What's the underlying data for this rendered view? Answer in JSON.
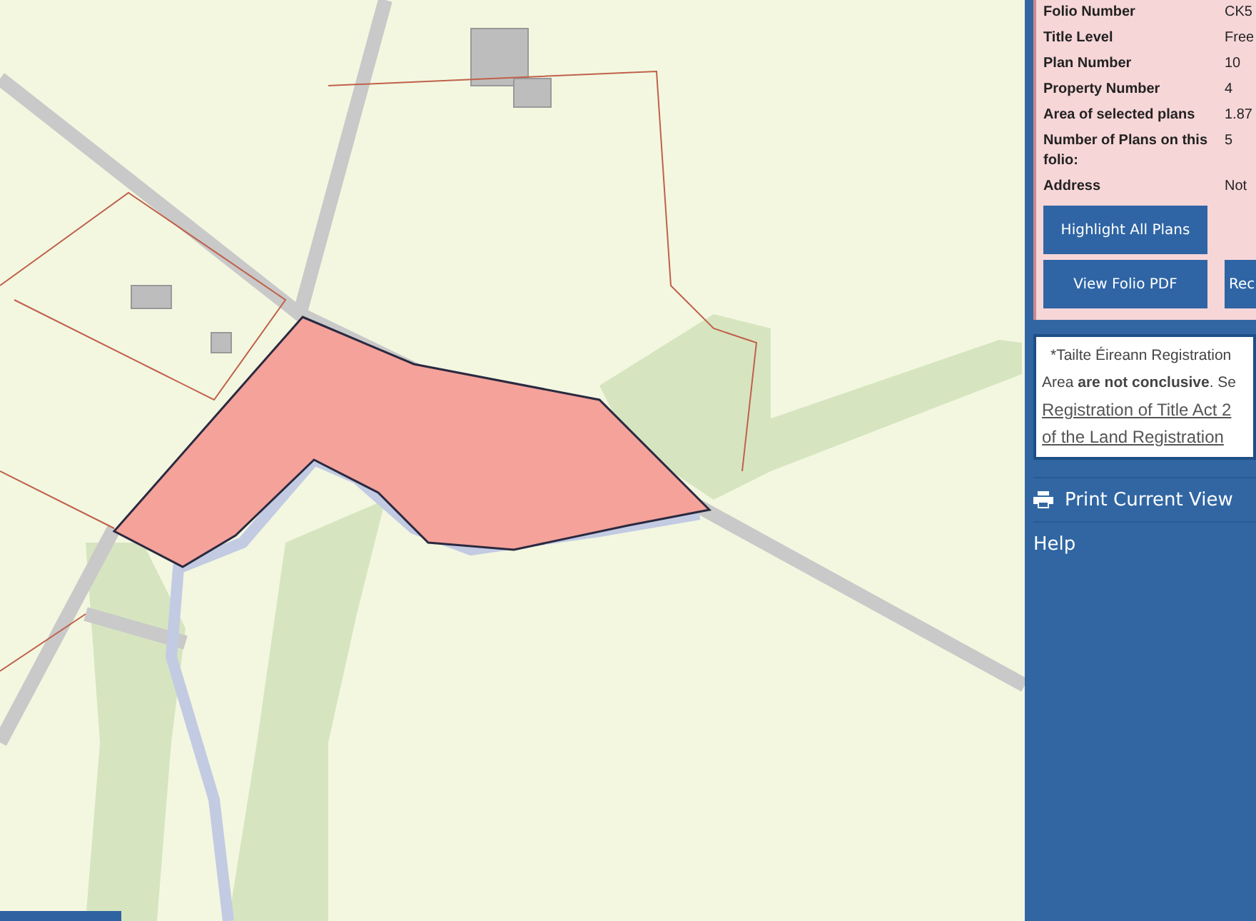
{
  "folio_details": {
    "rows": [
      {
        "label": "Folio Number",
        "value": "CK5"
      },
      {
        "label": "Title Level",
        "value": "Free"
      },
      {
        "label": "Plan Number",
        "value": "10"
      },
      {
        "label": "Property Number",
        "value": "4"
      },
      {
        "label": "Area of selected plans",
        "value": "1.87"
      },
      {
        "label": "Number of Plans on this folio:",
        "value": "5"
      },
      {
        "label": "Address",
        "value": "Not"
      }
    ],
    "buttons": [
      "Highlight All Plans",
      "View Folio PDF",
      "Rec"
    ]
  },
  "notice": {
    "lines": [
      "*Tailte Éireann Registration",
      "Area **are not conclusive**. Se"
    ],
    "link_lines": [
      "Registration of Title Act 2",
      "of the Land Registration"
    ]
  },
  "menu": [
    {
      "label": "Print Current View",
      "kind": "print"
    },
    {
      "label": "Help",
      "kind": "plain"
    }
  ]
}
